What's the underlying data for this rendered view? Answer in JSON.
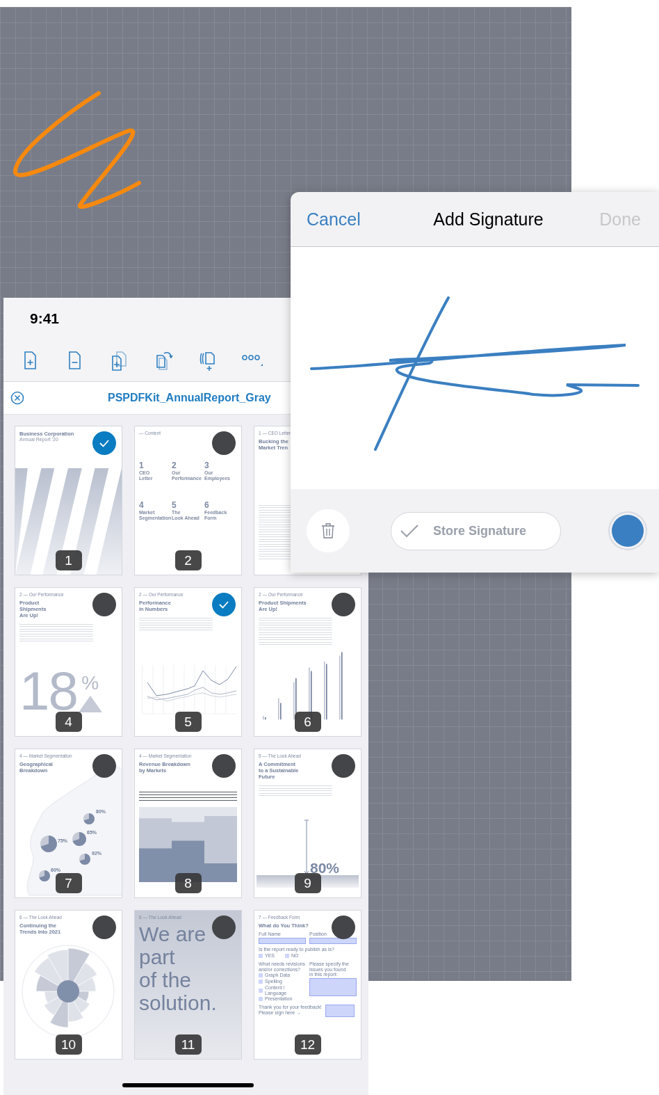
{
  "canvas": {
    "kind": "ink"
  },
  "status_bar": {
    "time": "9:41"
  },
  "toolbar": [
    {
      "kind": "add_page"
    },
    {
      "kind": "remove_page"
    },
    {
      "kind": "duplicate_page"
    },
    {
      "kind": "rotate_page"
    },
    {
      "kind": "copy_page"
    },
    {
      "kind": "more"
    }
  ],
  "document": {
    "title": "PSPDFKit_AnnualReport_Gray"
  },
  "pages": [
    {
      "number": "1",
      "selected": true,
      "kind": "cover",
      "title": "Business Corporation",
      "subtitle": "Annual Report '20"
    },
    {
      "number": "2",
      "selected": false,
      "kind": "contents",
      "kicker": "— Content",
      "entries": [
        {
          "num": "1",
          "label": "CEO\nLetter"
        },
        {
          "num": "2",
          "label": "Our\nPerformance"
        },
        {
          "num": "3",
          "label": "Our\nEmployees"
        },
        {
          "num": "4",
          "label": "Market\nSegmentation"
        },
        {
          "num": "5",
          "label": "The\nLook Ahead"
        },
        {
          "num": "6",
          "label": "Feedback\nForm"
        }
      ]
    },
    {
      "kind": "letter",
      "kicker": "1 — CEO Letter",
      "title": "Bucking the\nMarket Tren"
    },
    {
      "number": "4",
      "selected": false,
      "kind": "big_number",
      "kicker": "2 — Our Performance",
      "title": "Product\nShipments\nAre Up!",
      "figure": "18",
      "unit": "%"
    },
    {
      "number": "5",
      "selected": true,
      "kind": "line_chart",
      "kicker": "2 — Our Performance",
      "title": "Performance\nin Numbers"
    },
    {
      "number": "6",
      "selected": false,
      "kind": "bar_chart",
      "kicker": "2 — Our Performance",
      "title": "Product Shipments\nAre Up!"
    },
    {
      "number": "7",
      "selected": false,
      "kind": "map",
      "kicker": "4 — Market Segmentation",
      "title": "Geographical\nBreakdown",
      "labels": [
        "80%",
        "75%",
        "65%",
        "92%",
        "60%"
      ]
    },
    {
      "number": "8",
      "selected": false,
      "kind": "area",
      "kicker": "4 — Market Segmentation",
      "title": "Revenue Breakdown\nby Markets"
    },
    {
      "number": "9",
      "selected": false,
      "kind": "stat",
      "kicker": "5 — The Look Ahead",
      "title": "A Commitment\nto a Sustainable\nFuture",
      "figure": "80%"
    },
    {
      "number": "10",
      "selected": false,
      "kind": "radial",
      "kicker": "6 — The Look Ahead",
      "title": "Continuing the\nTrends Into 2021"
    },
    {
      "number": "11",
      "selected": false,
      "kind": "quote",
      "kicker": "6 — The Look Ahead",
      "quote": "We are\npart\nof the\nsolution."
    },
    {
      "number": "12",
      "selected": false,
      "kind": "form",
      "kicker": "7 — Feedback Form",
      "title": "What do You Think?",
      "fields": [
        "Full Name",
        "Position"
      ],
      "question": "Is the report ready to publish as is?",
      "choices": [
        {
          "label": "YES",
          "checked": false
        },
        {
          "label": "NO",
          "checked": false
        }
      ],
      "left_label": "What needs revisions\nand/or corrections?",
      "right_label": "Please specify the issues you found\nin this report:",
      "options": [
        {
          "label": "Graph Data",
          "checked": false
        },
        {
          "label": "Spelling",
          "checked": false
        },
        {
          "label": "Content / Language",
          "checked": false
        },
        {
          "label": "Presentation",
          "checked": false
        }
      ],
      "thanks": "Thank you for your feedback!\nPlease sign here →"
    }
  ],
  "signature_dialog": {
    "cancel": "Cancel",
    "title": "Add Signature",
    "done": "Done",
    "done_disabled": true,
    "store_button": "Store Signature"
  }
}
